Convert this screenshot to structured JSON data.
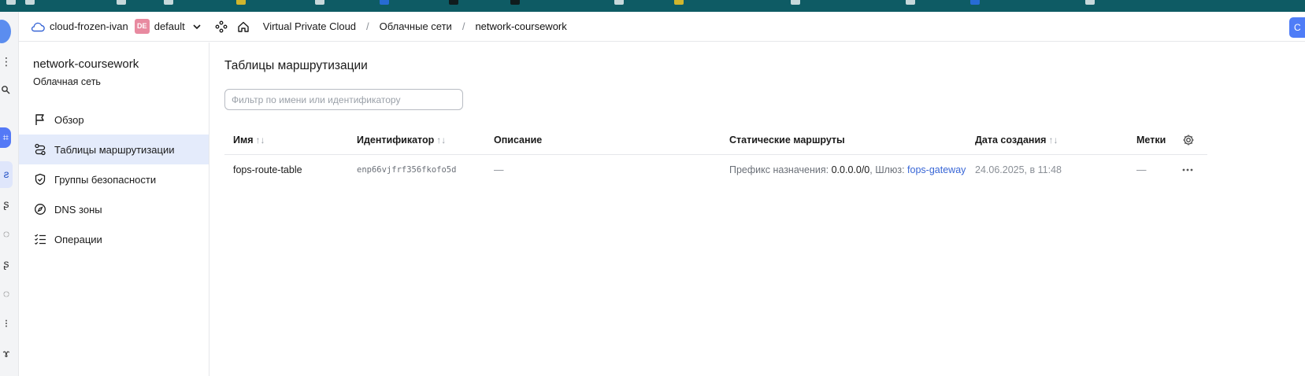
{
  "header": {
    "cloud_name": "cloud-frozen-ivan",
    "folder_badge": "DE",
    "folder_name": "default",
    "breadcrumbs": [
      "Virtual Private Cloud",
      "Облачные сети",
      "network-coursework"
    ],
    "breadcrumb_sep": "/"
  },
  "sidebar": {
    "title": "network-coursework",
    "subtitle": "Облачная сеть",
    "items": [
      {
        "label": "Обзор",
        "icon": "flag-icon"
      },
      {
        "label": "Таблицы маршрутизации",
        "icon": "route-icon",
        "active": true
      },
      {
        "label": "Группы безопасности",
        "icon": "shield-icon"
      },
      {
        "label": "DNS зоны",
        "icon": "compass-icon"
      },
      {
        "label": "Операции",
        "icon": "list-check-icon"
      }
    ]
  },
  "main": {
    "title": "Таблицы маршрутизации",
    "filter_placeholder": "Фильтр по имени или идентификатору",
    "sort_glyph": "↑↓",
    "columns": {
      "name": "Имя",
      "id": "Идентификатор",
      "description": "Описание",
      "routes": "Статические маршруты",
      "created": "Дата создания",
      "labels": "Метки"
    },
    "rows": [
      {
        "name": "fops-route-table",
        "id": "enp66vjfrf356fkofo5d",
        "description": "—",
        "route_prefix_label": "Префикс назначения:",
        "route_prefix_value": "0.0.0.0/0",
        "route_comma": ",",
        "route_gateway_label": "Шлюз:",
        "route_gateway_value": "fops-gateway",
        "created": "24.06.2025, в 11:48",
        "labels": "—"
      }
    ]
  },
  "colors": {
    "accent": "#3866d6",
    "active_nav": "#e4ebfb",
    "top_strip": "#0e5b64"
  }
}
